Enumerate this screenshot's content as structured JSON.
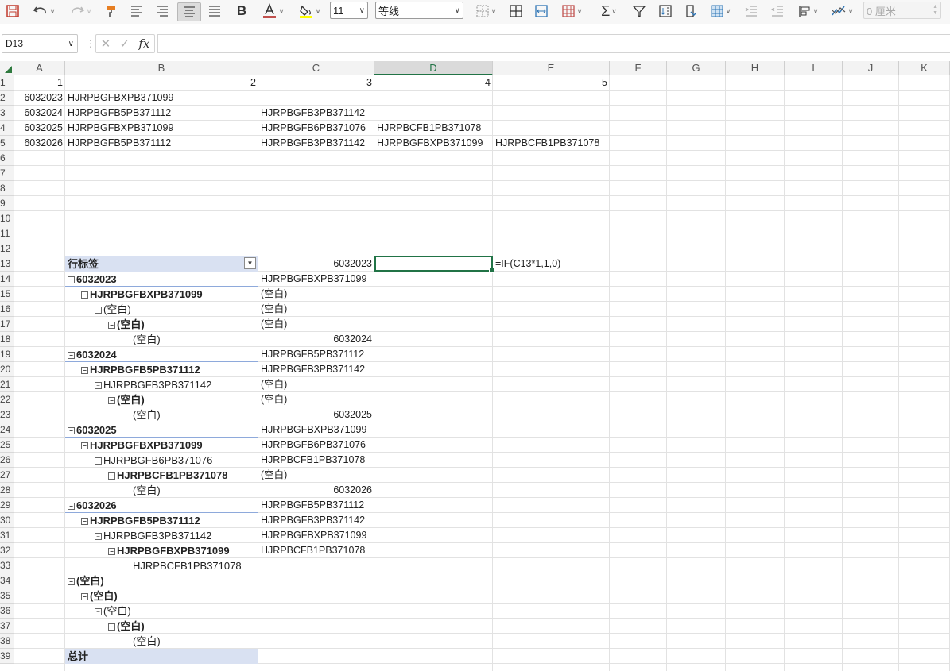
{
  "toolbar": {
    "font_size": "11",
    "font_name": "等线",
    "indent_value": "0 厘米",
    "colors": {
      "font_color": "#c0504d",
      "fill_color": "#ffff00",
      "accent": "#217346"
    }
  },
  "formula_bar": {
    "name_box": "D13",
    "fx_label": "fx",
    "formula": ""
  },
  "columns": [
    "A",
    "B",
    "C",
    "D",
    "E",
    "F",
    "G",
    "H",
    "I",
    "J",
    "K"
  ],
  "active_column": "D",
  "rows": [
    "1",
    "2",
    "3",
    "4",
    "5",
    "6",
    "7",
    "8",
    "9",
    "10",
    "11",
    "12",
    "13",
    "14",
    "15",
    "16",
    "17",
    "18",
    "19",
    "20",
    "21",
    "22",
    "23",
    "24",
    "25",
    "26",
    "27",
    "28",
    "29",
    "30",
    "31",
    "32",
    "33",
    "34",
    "35",
    "36",
    "37",
    "38",
    "39"
  ],
  "cells": {
    "A1": "1",
    "B1": "2",
    "C1": "3",
    "D1": "4",
    "E1": "5",
    "A2": "6032023",
    "B2": "HJRPBGFBXPB371099",
    "A3": "6032024",
    "B3": "HJRPBGFB5PB371112",
    "C3": "HJRPBGFB3PB371142",
    "A4": "6032025",
    "B4": "HJRPBGFBXPB371099",
    "C4": "HJRPBGFB6PB371076",
    "D4": "HJRPBCFB1PB371078",
    "A5": "6032026",
    "B5": "HJRPBGFB5PB371112",
    "C5": "HJRPBGFB3PB371142",
    "D5": "HJRPBGFBXPB371099",
    "E5": "HJRPBCFB1PB371078",
    "C13": "6032023",
    "E13": "=IF(C13*1,1,0)",
    "C14": "HJRPBGFBXPB371099",
    "C15": "(空白)",
    "C16": "(空白)",
    "C17": "(空白)",
    "C18": "6032024",
    "C19": "HJRPBGFB5PB371112",
    "C20": "HJRPBGFB3PB371142",
    "C21": "(空白)",
    "C22": "(空白)",
    "C23": "6032025",
    "C24": "HJRPBGFBXPB371099",
    "C25": "HJRPBGFB6PB371076",
    "C26": "HJRPBCFB1PB371078",
    "C27": "(空白)",
    "C28": "6032026",
    "C29": "HJRPBGFB5PB371112",
    "C30": "HJRPBGFB3PB371142",
    "C31": "HJRPBGFBXPB371099",
    "C32": "HJRPBCFB1PB371078"
  },
  "pivot": {
    "header": "行标签",
    "total": "总计",
    "items": [
      {
        "text": "6032023",
        "bold": true,
        "toggle": "⊟"
      },
      {
        "text": "HJRPBGFBXPB371099",
        "bold": true,
        "toggle": "⊟"
      },
      {
        "text": "(空白)",
        "bold": false,
        "toggle": "⊟"
      },
      {
        "text": "(空白)",
        "bold": true,
        "toggle": "⊟"
      },
      {
        "text": "(空白)",
        "bold": false,
        "toggle": ""
      },
      {
        "text": "6032024",
        "bold": true,
        "toggle": "⊟"
      },
      {
        "text": "HJRPBGFB5PB371112",
        "bold": true,
        "toggle": "⊟"
      },
      {
        "text": "HJRPBGFB3PB371142",
        "bold": false,
        "toggle": "⊟"
      },
      {
        "text": "(空白)",
        "bold": true,
        "toggle": "⊟"
      },
      {
        "text": "(空白)",
        "bold": false,
        "toggle": ""
      },
      {
        "text": "6032025",
        "bold": true,
        "toggle": "⊟"
      },
      {
        "text": "HJRPBGFBXPB371099",
        "bold": true,
        "toggle": "⊟"
      },
      {
        "text": "HJRPBGFB6PB371076",
        "bold": false,
        "toggle": "⊟"
      },
      {
        "text": "HJRPBCFB1PB371078",
        "bold": true,
        "toggle": "⊟"
      },
      {
        "text": "(空白)",
        "bold": false,
        "toggle": ""
      },
      {
        "text": "6032026",
        "bold": true,
        "toggle": "⊟"
      },
      {
        "text": "HJRPBGFB5PB371112",
        "bold": true,
        "toggle": "⊟"
      },
      {
        "text": "HJRPBGFB3PB371142",
        "bold": false,
        "toggle": "⊟"
      },
      {
        "text": "HJRPBGFBXPB371099",
        "bold": true,
        "toggle": "⊟"
      },
      {
        "text": "HJRPBCFB1PB371078",
        "bold": false,
        "toggle": ""
      },
      {
        "text": "(空白)",
        "bold": true,
        "toggle": "⊟"
      },
      {
        "text": "(空白)",
        "bold": true,
        "toggle": "⊟"
      },
      {
        "text": "(空白)",
        "bold": false,
        "toggle": "⊟"
      },
      {
        "text": "(空白)",
        "bold": true,
        "toggle": "⊟"
      },
      {
        "text": "(空白)",
        "bold": false,
        "toggle": ""
      }
    ]
  }
}
